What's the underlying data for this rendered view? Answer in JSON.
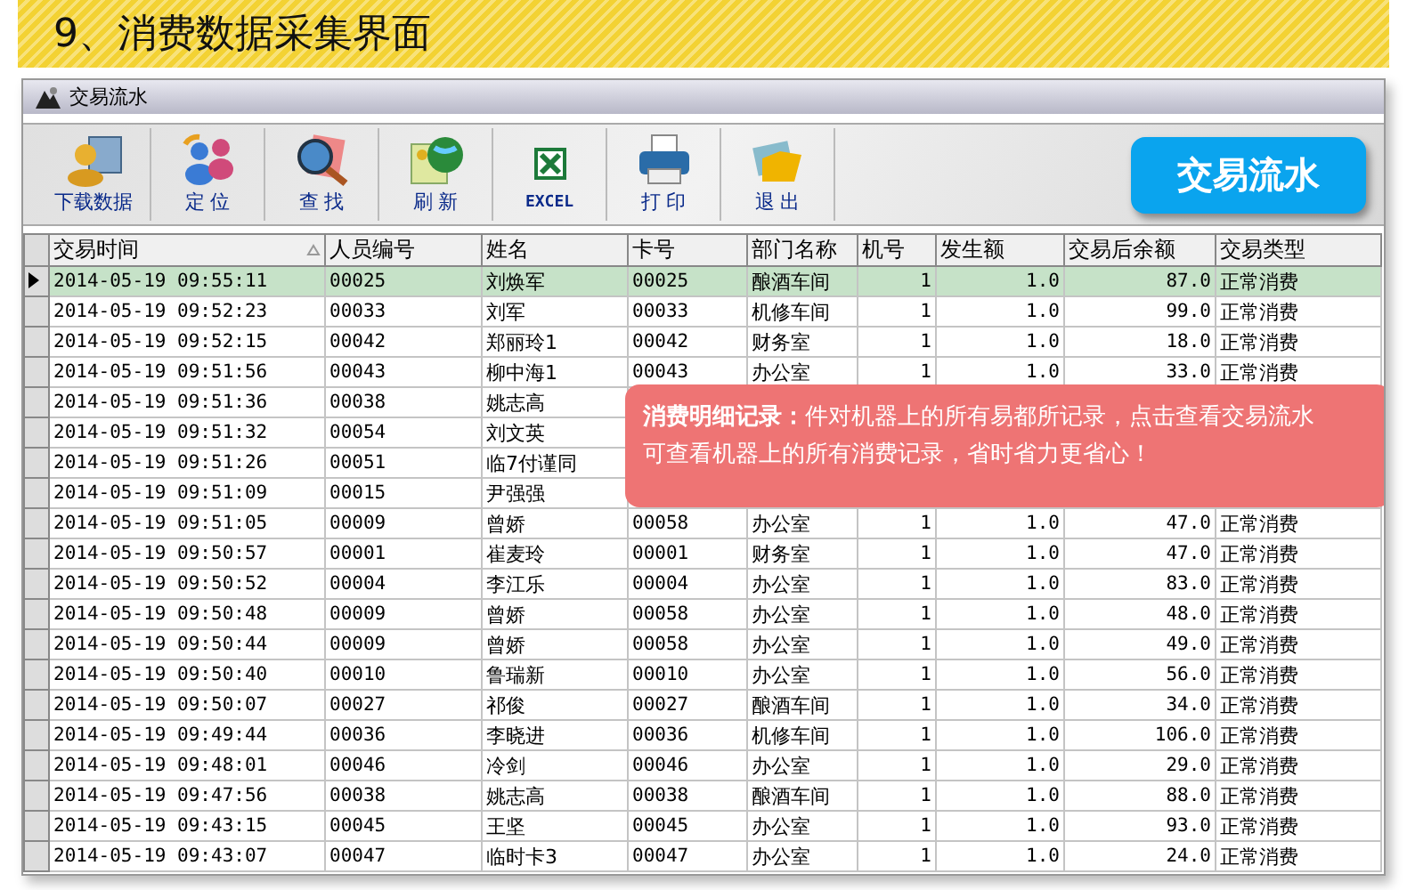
{
  "page_title": "9、消费数据采集界面",
  "window": {
    "title": "交易流水"
  },
  "toolbar": [
    {
      "kind": "download",
      "label": "下载数据"
    },
    {
      "kind": "locate",
      "label": "定 位"
    },
    {
      "kind": "find",
      "label": "查 找"
    },
    {
      "kind": "refresh",
      "label": "刷 新"
    },
    {
      "kind": "excel",
      "label": "EXCEL"
    },
    {
      "kind": "print",
      "label": "打 印"
    },
    {
      "kind": "exit",
      "label": "退 出"
    }
  ],
  "badge": "交易流水",
  "table": {
    "columns": [
      "交易时间",
      "人员编号",
      "姓名",
      "卡号",
      "部门名称",
      "机号",
      "发生额",
      "交易后余额",
      "交易类型"
    ],
    "rows": [
      {
        "selected": true,
        "cells": [
          "2014-05-19 09:55:11",
          "00025",
          "刘焕军",
          "00025",
          "酿酒车间",
          "1",
          "1.0",
          "87.0",
          "正常消费"
        ]
      },
      {
        "selected": false,
        "cells": [
          "2014-05-19 09:52:23",
          "00033",
          "刘军",
          "00033",
          "机修车间",
          "1",
          "1.0",
          "99.0",
          "正常消费"
        ]
      },
      {
        "selected": false,
        "cells": [
          "2014-05-19 09:52:15",
          "00042",
          "郑丽玲1",
          "00042",
          "财务室",
          "1",
          "1.0",
          "18.0",
          "正常消费"
        ]
      },
      {
        "selected": false,
        "cells": [
          "2014-05-19 09:51:56",
          "00043",
          "柳中海1",
          "00043",
          "办公室",
          "1",
          "1.0",
          "33.0",
          "正常消费"
        ]
      },
      {
        "selected": false,
        "cells": [
          "2014-05-19 09:51:36",
          "00038",
          "姚志高"
        ]
      },
      {
        "selected": false,
        "cells": [
          "2014-05-19 09:51:32",
          "00054",
          "刘文英"
        ]
      },
      {
        "selected": false,
        "cells": [
          "2014-05-19 09:51:26",
          "00051",
          "临7付谨同"
        ]
      },
      {
        "selected": false,
        "cells": [
          "2014-05-19 09:51:09",
          "00015",
          "尹强强"
        ]
      },
      {
        "selected": false,
        "cells": [
          "2014-05-19 09:51:05",
          "00009",
          "曾娇",
          "00058",
          "办公室",
          "1",
          "1.0",
          "47.0",
          "正常消费"
        ]
      },
      {
        "selected": false,
        "cells": [
          "2014-05-19 09:50:57",
          "00001",
          "崔麦玲",
          "00001",
          "财务室",
          "1",
          "1.0",
          "47.0",
          "正常消费"
        ]
      },
      {
        "selected": false,
        "cells": [
          "2014-05-19 09:50:52",
          "00004",
          "李江乐",
          "00004",
          "办公室",
          "1",
          "1.0",
          "83.0",
          "正常消费"
        ]
      },
      {
        "selected": false,
        "cells": [
          "2014-05-19 09:50:48",
          "00009",
          "曾娇",
          "00058",
          "办公室",
          "1",
          "1.0",
          "48.0",
          "正常消费"
        ]
      },
      {
        "selected": false,
        "cells": [
          "2014-05-19 09:50:44",
          "00009",
          "曾娇",
          "00058",
          "办公室",
          "1",
          "1.0",
          "49.0",
          "正常消费"
        ]
      },
      {
        "selected": false,
        "cells": [
          "2014-05-19 09:50:40",
          "00010",
          "鲁瑞新",
          "00010",
          "办公室",
          "1",
          "1.0",
          "56.0",
          "正常消费"
        ]
      },
      {
        "selected": false,
        "cells": [
          "2014-05-19 09:50:07",
          "00027",
          "祁俊",
          "00027",
          "酿酒车间",
          "1",
          "1.0",
          "34.0",
          "正常消费"
        ]
      },
      {
        "selected": false,
        "cells": [
          "2014-05-19 09:49:44",
          "00036",
          "李晓进",
          "00036",
          "机修车间",
          "1",
          "1.0",
          "106.0",
          "正常消费"
        ]
      },
      {
        "selected": false,
        "cells": [
          "2014-05-19 09:48:01",
          "00046",
          "冷剑",
          "00046",
          "办公室",
          "1",
          "1.0",
          "29.0",
          "正常消费"
        ]
      },
      {
        "selected": false,
        "cells": [
          "2014-05-19 09:47:56",
          "00038",
          "姚志高",
          "00038",
          "酿酒车间",
          "1",
          "1.0",
          "88.0",
          "正常消费"
        ]
      },
      {
        "selected": false,
        "cells": [
          "2014-05-19 09:43:15",
          "00045",
          "王坚",
          "00045",
          "办公室",
          "1",
          "1.0",
          "93.0",
          "正常消费"
        ]
      },
      {
        "selected": false,
        "cells": [
          "2014-05-19 09:43:07",
          "00047",
          "临时卡3",
          "00047",
          "办公室",
          "1",
          "1.0",
          "24.0",
          "正常消费"
        ]
      }
    ]
  },
  "callout": "**消费明细记录：**件对机器上的所有易都所记录，点击查看交易流水可查看机器上的所有消费记录，省时省力更省心！"
}
